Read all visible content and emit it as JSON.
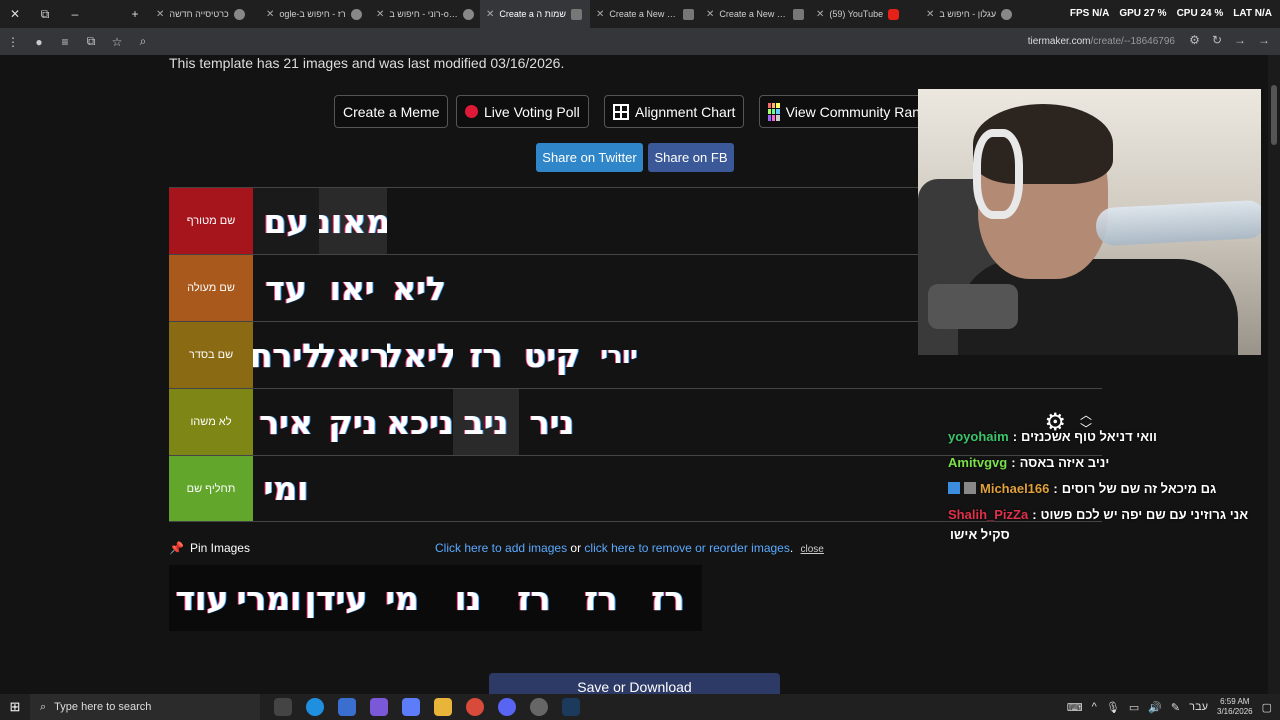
{
  "browser": {
    "tabs": [
      {
        "label": "כרטיסייה חדשה",
        "icon": "chrome-icon",
        "active": false
      },
      {
        "label": "ogle-רז - חיפוש ב",
        "icon": "google-icon",
        "active": false
      },
      {
        "label": "רוני - חיפוש ב-ogle",
        "icon": "google-icon",
        "active": false
      },
      {
        "label": "Create a שמות ה",
        "icon": "tiermaker-icon",
        "active": true
      },
      {
        "label": "Create a New Tier",
        "icon": "tiermaker-icon",
        "active": false
      },
      {
        "label": "Create a New Tier",
        "icon": "tiermaker-icon",
        "active": false
      },
      {
        "label": "(59) YouTube",
        "icon": "youtube-icon",
        "active": false
      },
      {
        "label": "עגלון - חיפוש ב",
        "icon": "google-icon",
        "active": false
      }
    ],
    "stats": {
      "fps_label": "FPS",
      "fps": "N/A",
      "gpu_label": "GPU",
      "gpu": "27 %",
      "cpu_label": "CPU",
      "cpu": "24 %",
      "lat_label": "LAT",
      "lat": "N/A"
    },
    "url_host": "tiermaker.com",
    "url_path": "/create/--18646796"
  },
  "page": {
    "template_info": "This template has 21 images and was last modified 03/16/2026.",
    "buttons": {
      "create_meme": "Create a Meme",
      "live_voting": "Live Voting Poll",
      "alignment": "Alignment Chart",
      "community": "View Community Ran"
    },
    "share_twitter": "Share on Twitter",
    "share_fb": "Share on FB",
    "tiers": [
      {
        "label": "שם מטורף",
        "color": "#a7151c",
        "items": [
          "מאונ",
          "עם"
        ]
      },
      {
        "label": "שם מעולה",
        "color": "#a8591b",
        "items": [
          "ליא",
          "יאו",
          "עד"
        ]
      },
      {
        "label": "שם בסדר",
        "color": "#8a6a12",
        "items": [
          "לירח",
          "ריאל",
          "ליאל",
          "רז",
          "קיט",
          "יורי"
        ]
      },
      {
        "label": "לא משהו",
        "color": "#7e8615",
        "items": [
          "איר",
          "ניק",
          "ניכא",
          "ניב",
          "ניר"
        ]
      },
      {
        "label": "תחליף שם",
        "color": "#62a72c",
        "items": [
          "ומי"
        ]
      }
    ],
    "pin_images": "Pin Images",
    "add_images_link": "Click here to add images",
    "or_text": " or ",
    "remove_images_link": "click here to remove or reorder images",
    "close_link": "close",
    "pool_items": [
      "עוד",
      "ומרי",
      "עידן",
      "מי",
      "נו",
      "רז",
      "רז",
      "רז",
      "רז"
    ],
    "save_button": "Save or Download"
  },
  "chat": [
    {
      "user": "yoyohaim",
      "color": "#3cc46b",
      "text": "וואי דניאל טוף אשכנזים",
      "badges": 0
    },
    {
      "user": "Amitvgvg",
      "color": "#7be04a",
      "text": "יניב איזה באסה",
      "badges": 0
    },
    {
      "user": "Michael166",
      "color": "#e0a13a",
      "text": "גם מיכאל זה שם של רוסים",
      "badges": 2
    },
    {
      "user": "Shalih_PizZa",
      "color": "#e0304a",
      "text": "אני גרוזיני עם שם יפה יש לכם פשוט",
      "badges": 0
    }
  ],
  "chat_continuation": "סקיל אישו",
  "taskbar": {
    "search_placeholder": "Type here to search",
    "lang": "עבר",
    "time": "6:59 AM",
    "date": "3/16/2026"
  }
}
